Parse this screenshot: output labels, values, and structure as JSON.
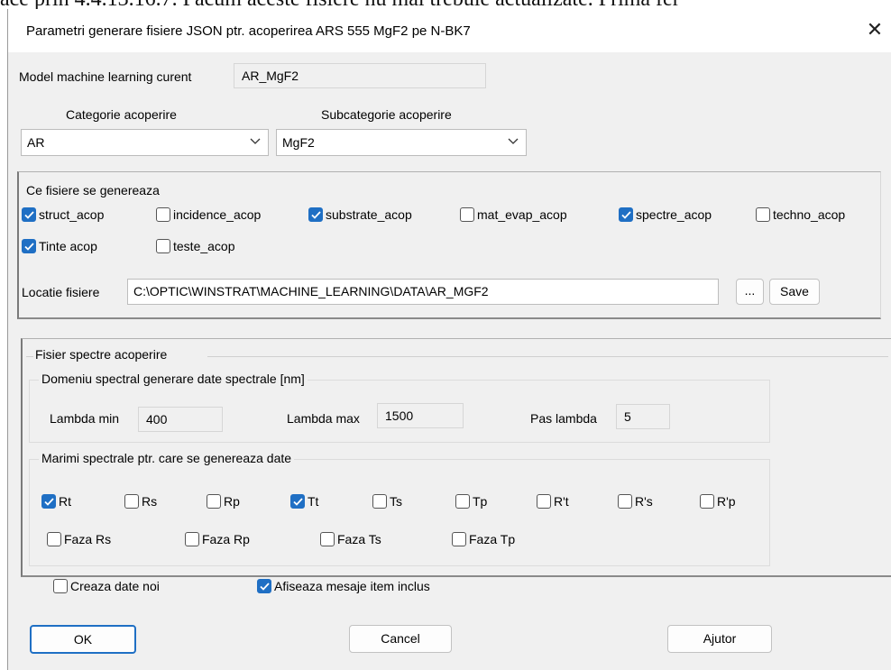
{
  "background_text": "ace prin 4.4.13.16.7. Pacum aceste fisiere nu mai trebuie actualizate. Prima fer",
  "dialog": {
    "title": "Parametri generare fisiere JSON ptr. acoperirea ARS 555 MgF2 pe N-BK7",
    "close_glyph": "✕"
  },
  "model": {
    "label": "Model machine learning curent",
    "value": "AR_MgF2"
  },
  "category": {
    "label": "Categorie acoperire",
    "value": "AR"
  },
  "subcategory": {
    "label": "Subcategorie acoperire",
    "value": "MgF2"
  },
  "files_group": {
    "legend": "Ce fisiere se genereaza",
    "items": [
      {
        "label": "struct_acop",
        "checked": true
      },
      {
        "label": "incidence_acop",
        "checked": false
      },
      {
        "label": "substrate_acop",
        "checked": true
      },
      {
        "label": "mat_evap_acop",
        "checked": false
      },
      {
        "label": "spectre_acop",
        "checked": true
      },
      {
        "label": "techno_acop",
        "checked": false
      },
      {
        "label": "Tinte acop",
        "checked": true
      },
      {
        "label": "teste_acop",
        "checked": false
      }
    ],
    "location_label": "Locatie fisiere",
    "location_value": "C:\\OPTIC\\WINSTRAT\\MACHINE_LEARNING\\DATA\\AR_MGF2",
    "browse_label": "...",
    "save_label": "Save"
  },
  "spectra_group": {
    "legend": "Fisier spectre acoperire",
    "range_group": {
      "legend": "Domeniu spectral generare date spectrale [nm]",
      "lambda_min_label": "Lambda min",
      "lambda_min_value": "400",
      "lambda_max_label": "Lambda max",
      "lambda_max_value": "1500",
      "step_label": "Pas lambda",
      "step_value": "5"
    },
    "quantities_group": {
      "legend": "Marimi spectrale ptr. care se genereaza date",
      "items": [
        {
          "label": "Rt",
          "checked": true
        },
        {
          "label": "Rs",
          "checked": false
        },
        {
          "label": "Rp",
          "checked": false
        },
        {
          "label": "Tt",
          "checked": true
        },
        {
          "label": "Ts",
          "checked": false
        },
        {
          "label": "Tp",
          "checked": false
        },
        {
          "label": "R't",
          "checked": false
        },
        {
          "label": "R's",
          "checked": false
        },
        {
          "label": "R'p",
          "checked": false
        },
        {
          "label": "Faza Rs",
          "checked": false
        },
        {
          "label": "Faza Rp",
          "checked": false
        },
        {
          "label": "Faza Ts",
          "checked": false
        },
        {
          "label": "Faza Tp",
          "checked": false
        }
      ]
    }
  },
  "bottom_options": [
    {
      "label": "Creaza date noi",
      "checked": false
    },
    {
      "label": "Afiseaza mesaje item inclus",
      "checked": true
    }
  ],
  "buttons": {
    "ok": "OK",
    "cancel": "Cancel",
    "help": "Ajutor"
  },
  "colors": {
    "accent": "#1f6fc4",
    "dialog_bg": "#f0f0f0"
  }
}
